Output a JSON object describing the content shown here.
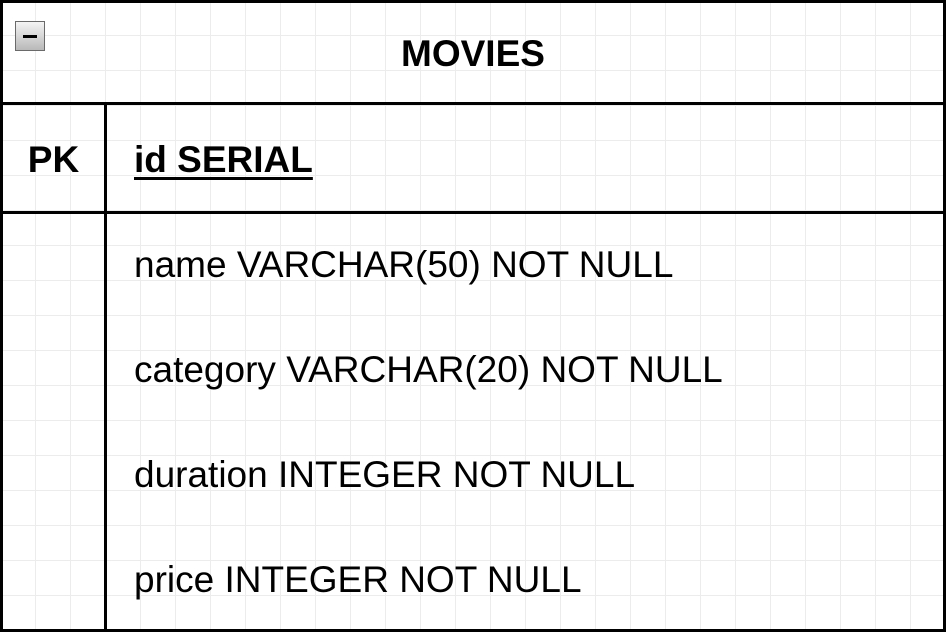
{
  "table": {
    "title": "MOVIES",
    "key_label": "PK",
    "primary_key_field": "id SERIAL",
    "fields": [
      "name VARCHAR(50) NOT NULL",
      "category VARCHAR(20) NOT NULL",
      "duration INTEGER NOT NULL",
      "price INTEGER NOT NULL"
    ]
  },
  "colors": {
    "border": "#000000",
    "grid": "#ececec",
    "background": "#ffffff"
  },
  "icons": {
    "collapse": "minus-icon"
  }
}
